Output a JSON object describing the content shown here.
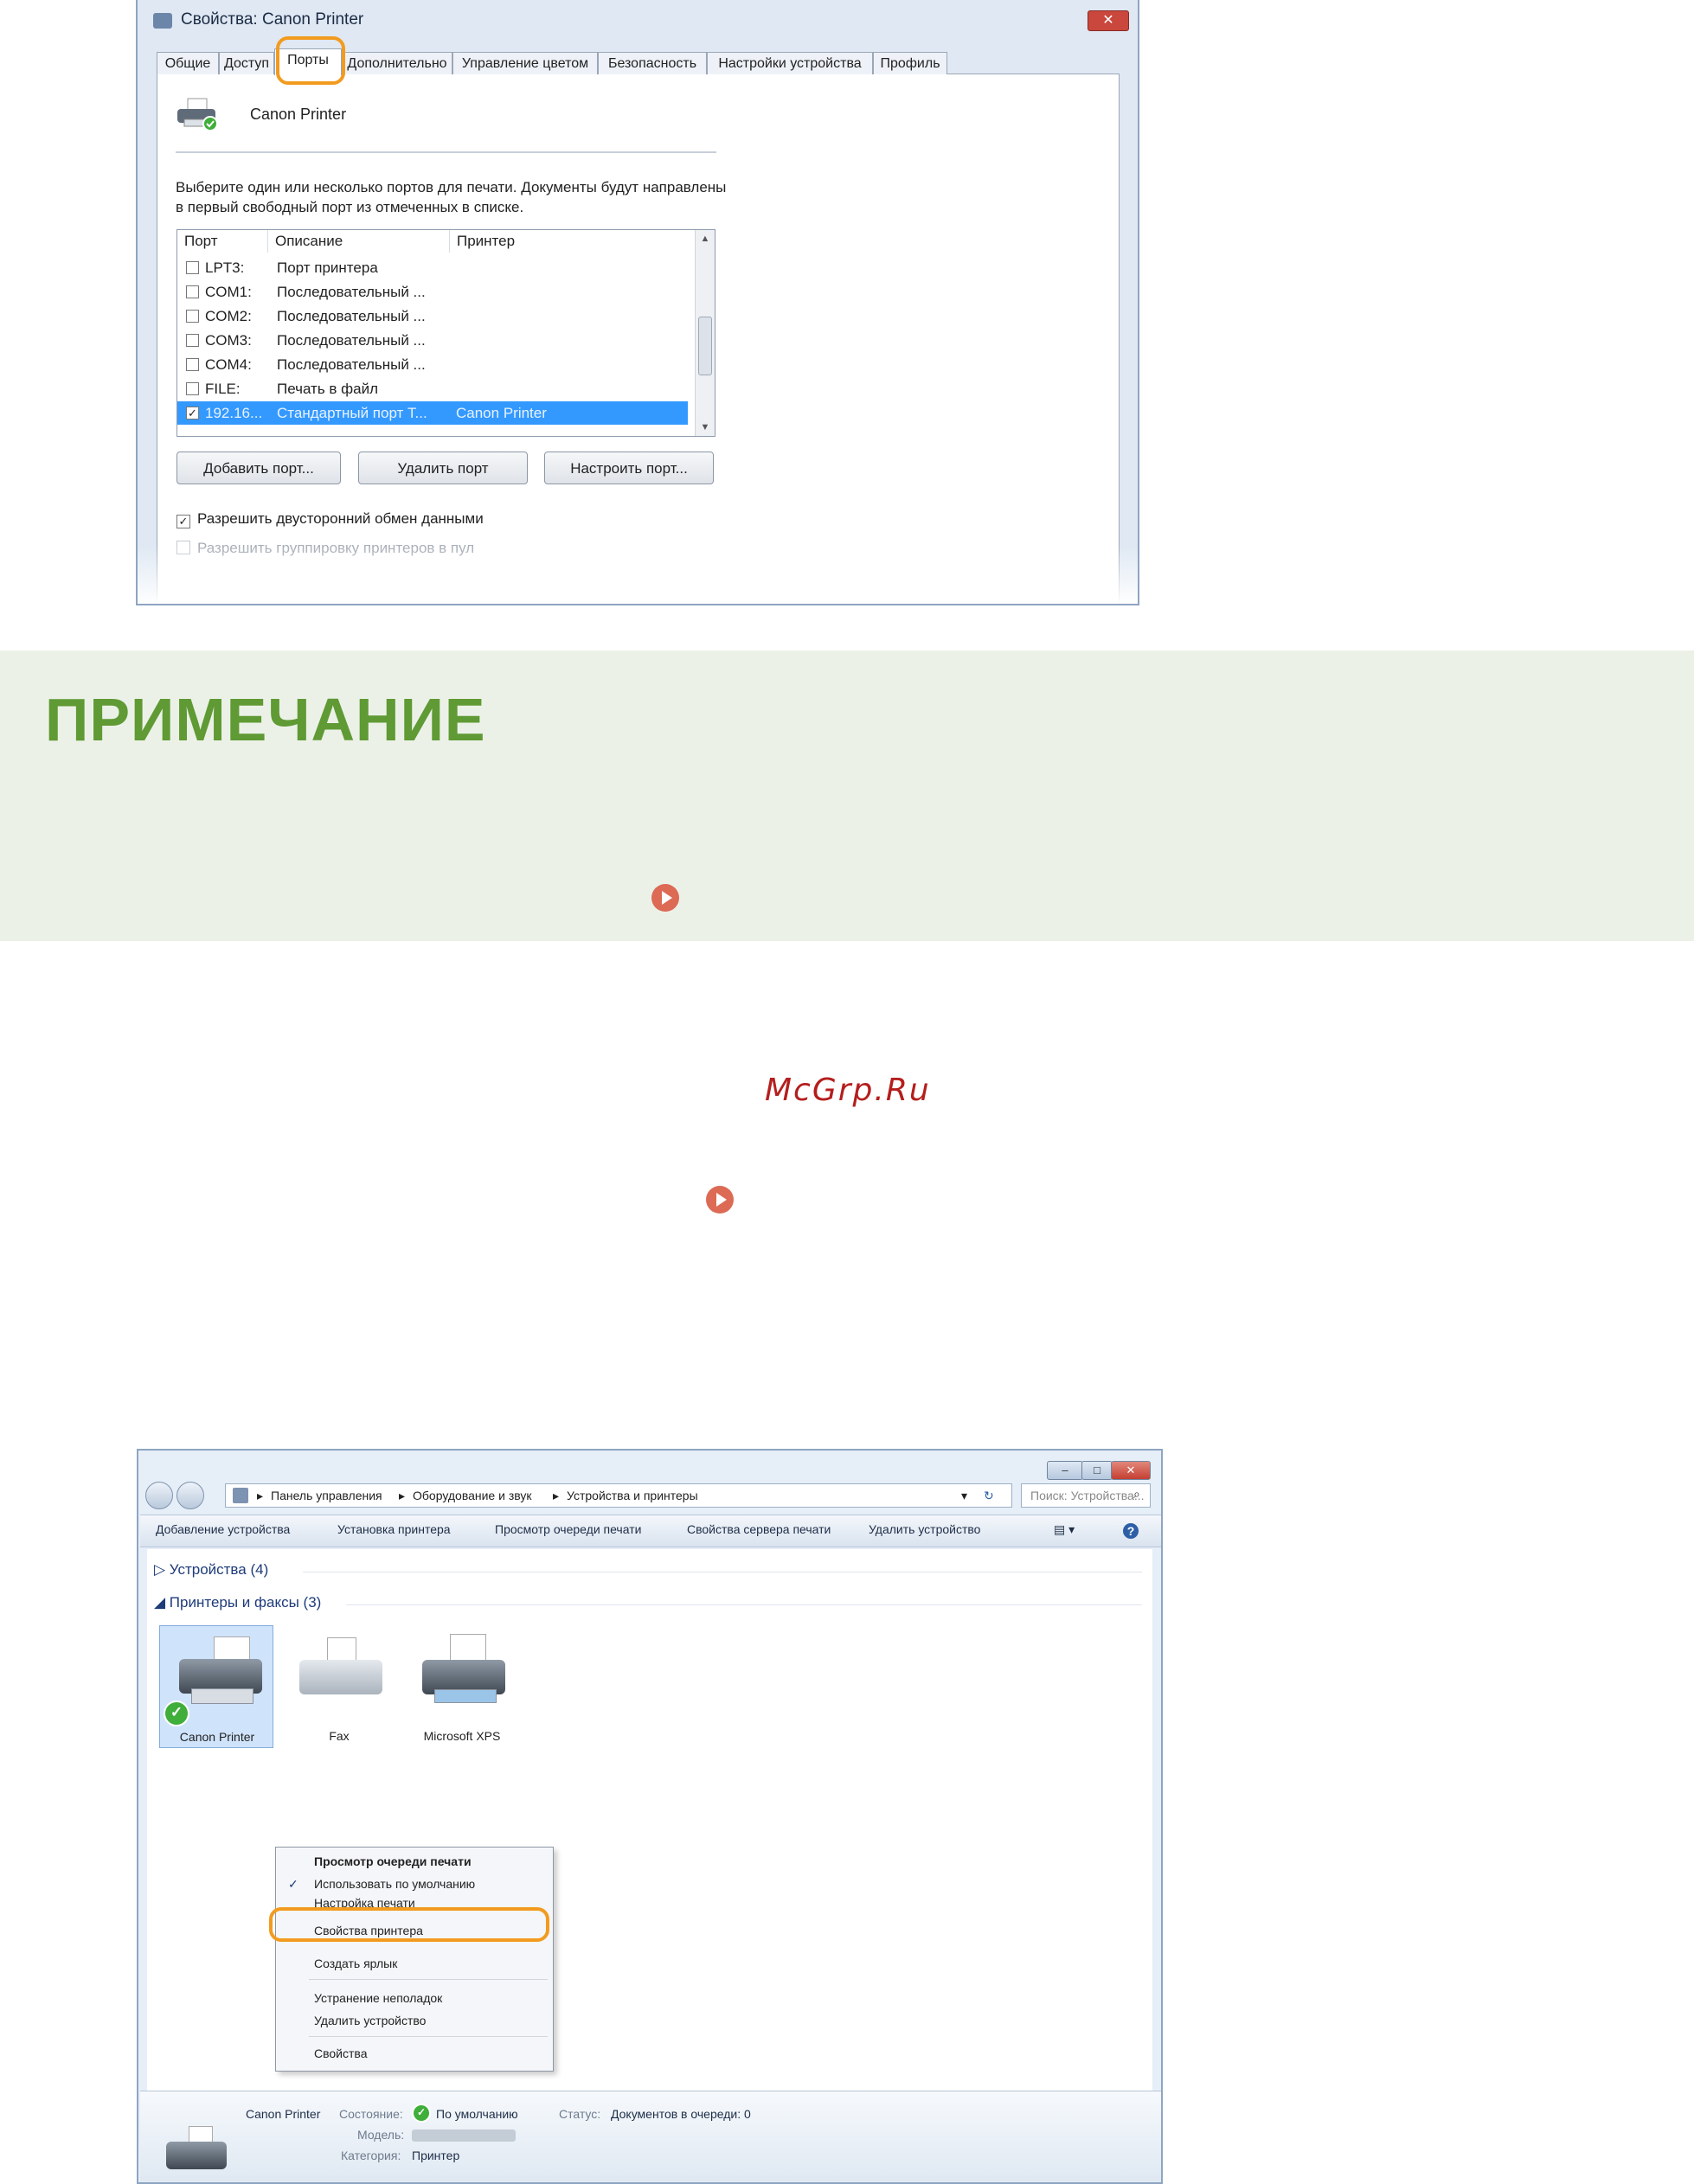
{
  "props_dialog": {
    "title": "Свойства: Canon Printer",
    "close_label": "✕",
    "tabs": [
      "Общие",
      "Доступ",
      "Порты",
      "Дополнительно",
      "Управление цветом",
      "Безопасность",
      "Настройки устройства",
      "Профиль"
    ],
    "active_tab": "Порты",
    "printer_name": "Canon Printer",
    "description": "Выберите один или несколько портов для печати. Документы будут направлены в первый свободный порт из отмеченных в списке.",
    "columns": [
      "Порт",
      "Описание",
      "Принтер"
    ],
    "ports": [
      {
        "port": "LPT3:",
        "description": "Порт принтера",
        "printer": "",
        "checked": false,
        "selected": false
      },
      {
        "port": "COM1:",
        "description": "Последовательный ...",
        "printer": "",
        "checked": false,
        "selected": false
      },
      {
        "port": "COM2:",
        "description": "Последовательный ...",
        "printer": "",
        "checked": false,
        "selected": false
      },
      {
        "port": "COM3:",
        "description": "Последовательный ...",
        "printer": "",
        "checked": false,
        "selected": false
      },
      {
        "port": "COM4:",
        "description": "Последовательный ...",
        "printer": "",
        "checked": false,
        "selected": false
      },
      {
        "port": "FILE:",
        "description": "Печать в файл",
        "printer": "",
        "checked": false,
        "selected": false
      },
      {
        "port": "192.16...",
        "description": "Стандартный порт T...",
        "printer": "Canon Printer",
        "checked": true,
        "selected": true
      }
    ],
    "buttons": {
      "add": "Добавить порт...",
      "delete": "Удалить порт",
      "configure": "Настроить порт..."
    },
    "options": {
      "bidirectional": "Разрешить двусторонний обмен данными",
      "pooling": "Разрешить группировку принтеров в пул"
    }
  },
  "note": {
    "heading": "ПРИМЕЧАНИЕ"
  },
  "watermark": "McGrp.Ru",
  "explorer": {
    "breadcrumb": [
      "Панель управления",
      "Оборудование и звук",
      "Устройства и принтеры"
    ],
    "search_placeholder": "Поиск: Устройства...",
    "toolbar": [
      "Добавление устройства",
      "Установка принтера",
      "Просмотр очереди печати",
      "Свойства сервера печати",
      "Удалить устройство"
    ],
    "groups": {
      "devices": "Устройства (4)",
      "printers": "Принтеры и факсы (3)"
    },
    "devices": [
      {
        "label": "Canon Printer"
      },
      {
        "label": "Fax"
      },
      {
        "label": "Microsoft XPS"
      }
    ],
    "context_menu": [
      {
        "label": "Просмотр очереди печати",
        "bold": true,
        "checked": false
      },
      {
        "label": "Использовать по умолчанию",
        "bold": false,
        "checked": true
      },
      {
        "label": "Настройка печати",
        "bold": false,
        "checked": false
      },
      {
        "label": "Свойства принтера",
        "bold": false,
        "checked": false
      },
      {
        "label": "Создать ярлык",
        "bold": false,
        "checked": false
      },
      {
        "label": "Устранение неполадок",
        "bold": false,
        "checked": false
      },
      {
        "label": "Удалить устройство",
        "bold": false,
        "checked": false
      },
      {
        "label": "Свойства",
        "bold": false,
        "checked": false
      }
    ],
    "details": {
      "name": "Canon Printer",
      "state_key": "Состояние:",
      "state_value": "По умолчанию",
      "status_key": "Статус:",
      "status_value": "Документов в очереди: 0",
      "model_key": "Модель:",
      "category_key": "Категория:",
      "category_value": "Принтер"
    }
  }
}
